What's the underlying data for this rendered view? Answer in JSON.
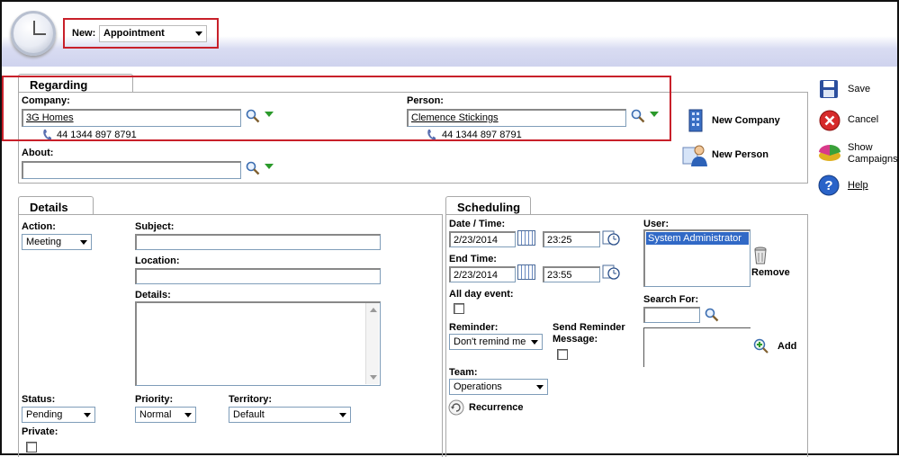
{
  "header": {
    "new_label": "New:",
    "new_value": "Appointment"
  },
  "regarding": {
    "tab_label": "Regarding",
    "company_label": "Company:",
    "company_value": "3G Homes",
    "company_phone": "44 1344 897 8791",
    "person_label": "Person:",
    "person_value": "Clemence Stickings",
    "person_phone": "44 1344 897 8791",
    "about_label": "About:",
    "about_value": "",
    "new_company": "New Company",
    "new_person": "New Person"
  },
  "actions": {
    "save": "Save",
    "cancel": "Cancel",
    "show_campaigns_1": "Show",
    "show_campaigns_2": "Campaigns",
    "help": "Help"
  },
  "details": {
    "tab_label": "Details",
    "action_label": "Action:",
    "action_value": "Meeting",
    "subject_label": "Subject:",
    "location_label": "Location:",
    "details_label": "Details:",
    "status_label": "Status:",
    "status_value": "Pending",
    "priority_label": "Priority:",
    "priority_value": "Normal",
    "territory_label": "Territory:",
    "territory_value": "Default",
    "private_label": "Private:"
  },
  "scheduling": {
    "tab_label": "Scheduling",
    "date_time_label": "Date / Time:",
    "date_value": "2/23/2014",
    "time_value": "23:25",
    "end_time_label": "End Time:",
    "end_date_value": "2/23/2014",
    "end_time_value": "23:55",
    "all_day_label": "All day event:",
    "reminder_label": "Reminder:",
    "reminder_value": "Don't remind me",
    "send_reminder_label_1": "Send Reminder",
    "send_reminder_label_2": "Message:",
    "team_label": "Team:",
    "team_value": "Operations",
    "recurrence_label": "Recurrence",
    "user_label": "User:",
    "user_selected": "System Administrator",
    "remove_label": "Remove",
    "search_for_label": "Search For:",
    "add_label": "Add"
  }
}
